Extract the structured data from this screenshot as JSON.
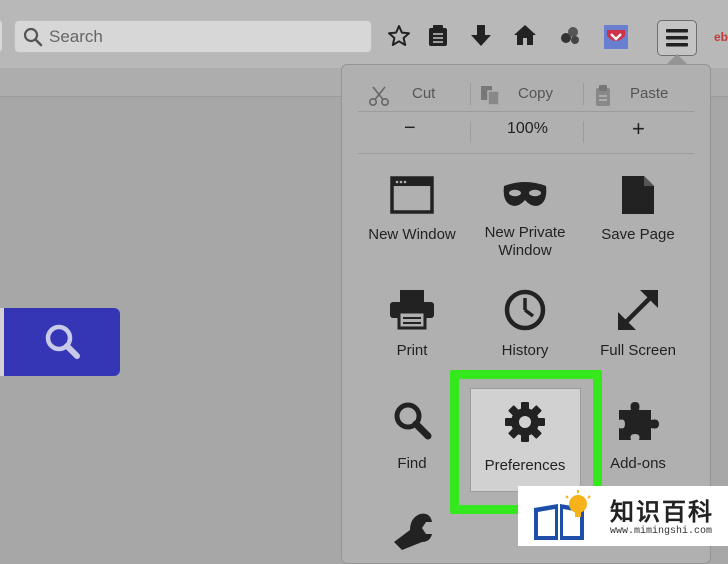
{
  "toolbar": {
    "search_placeholder": "Search",
    "icons": [
      "star-icon",
      "reading-list-icon",
      "download-icon",
      "home-icon",
      "sync-icon",
      "pocket-icon",
      "hamburger-menu-icon"
    ],
    "edge_label": "eb"
  },
  "menu": {
    "edit": {
      "cut": "Cut",
      "copy": "Copy",
      "paste": "Paste"
    },
    "zoom": {
      "minus": "−",
      "level": "100%",
      "plus": "+"
    },
    "items": [
      {
        "label": "New Window",
        "icon": "new-window-icon"
      },
      {
        "label": "New Private\nWindow",
        "icon": "private-mask-icon"
      },
      {
        "label": "Save Page",
        "icon": "save-page-icon"
      },
      {
        "label": "Print",
        "icon": "printer-icon"
      },
      {
        "label": "History",
        "icon": "clock-icon"
      },
      {
        "label": "Full Screen",
        "icon": "fullscreen-arrows-icon"
      },
      {
        "label": "Find",
        "icon": "magnifier-icon"
      },
      {
        "label": "Preferences",
        "icon": "gear-icon"
      },
      {
        "label": "Add-ons",
        "icon": "puzzle-piece-icon"
      }
    ],
    "highlight_color": "#35e81e"
  },
  "watermark": {
    "title": "知识百科",
    "url": "www.mimingshi.com"
  }
}
